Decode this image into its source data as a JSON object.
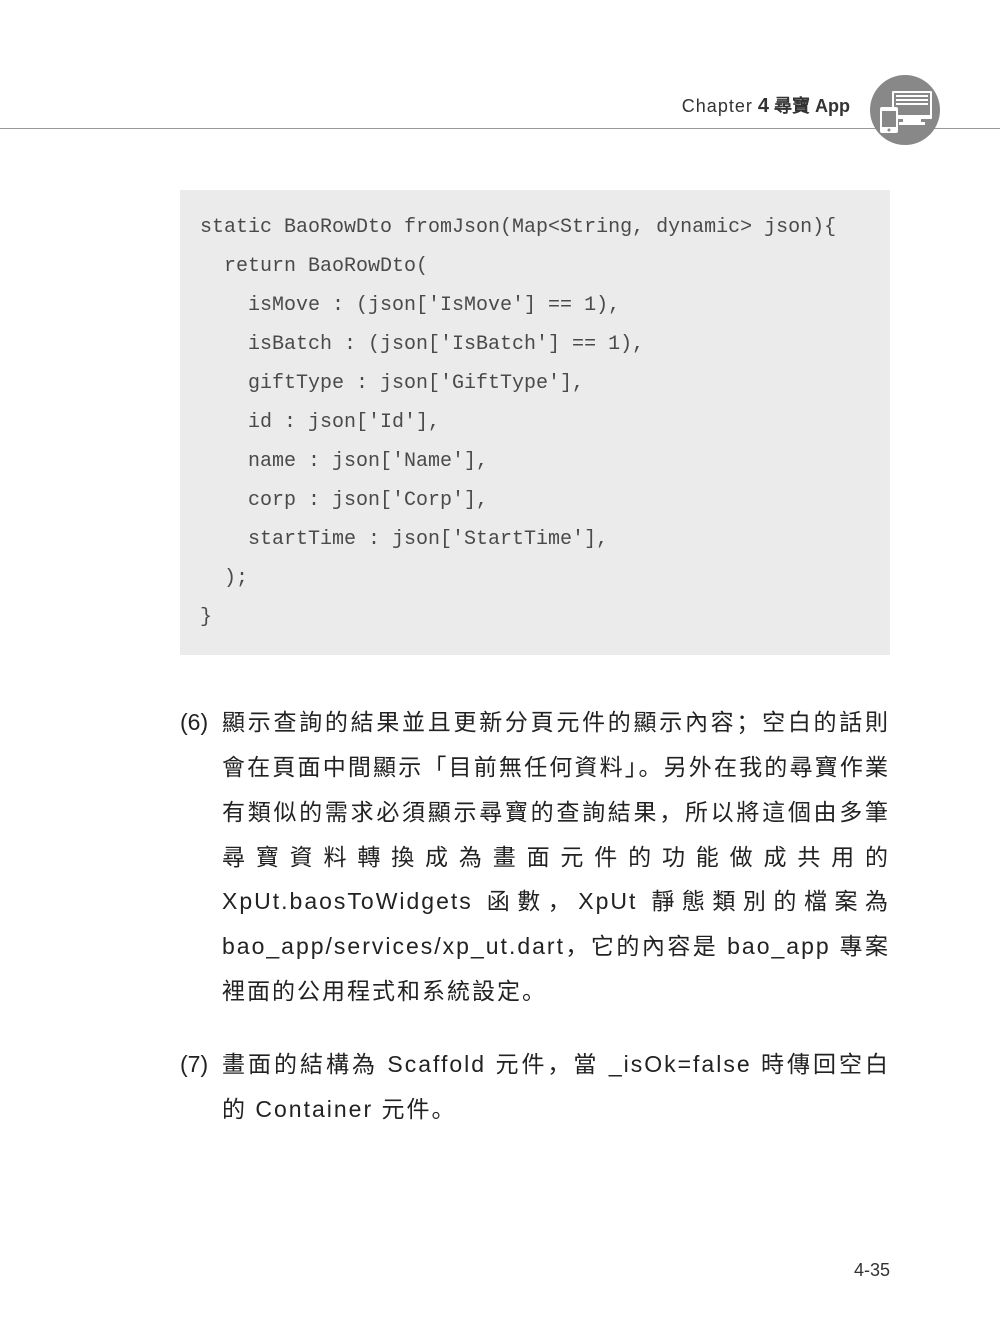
{
  "header": {
    "chapter_label": "Chapter",
    "chapter_number": "4",
    "chapter_title": "尋寶 App"
  },
  "code": {
    "content": "static BaoRowDto fromJson(Map<String, dynamic> json){\n  return BaoRowDto(\n    isMove : (json['IsMove'] == 1),\n    isBatch : (json['IsBatch'] == 1),\n    giftType : json['GiftType'],\n    id : json['Id'],\n    name : json['Name'],\n    corp : json['Corp'],\n    startTime : json['StartTime'],\n  );\n}"
  },
  "paragraphs": [
    {
      "number": "(6)",
      "text": "顯示查詢的結果並且更新分頁元件的顯示內容；空白的話則會在頁面中間顯示「目前無任何資料」。另外在我的尋寶作業有類似的需求必須顯示尋寶的查詢結果，所以將這個由多筆尋寶資料轉換成為畫面元件的功能做成共用的 XpUt.baosToWidgets 函數，XpUt 靜態類別的檔案為 bao_app/services/xp_ut.dart，它的內容是 bao_app 專案裡面的公用程式和系統設定。"
    },
    {
      "number": "(7)",
      "text": "畫面的結構為 Scaffold 元件，當 _isOk=false 時傳回空白的 Container 元件。"
    }
  ],
  "page_number": "4-35"
}
